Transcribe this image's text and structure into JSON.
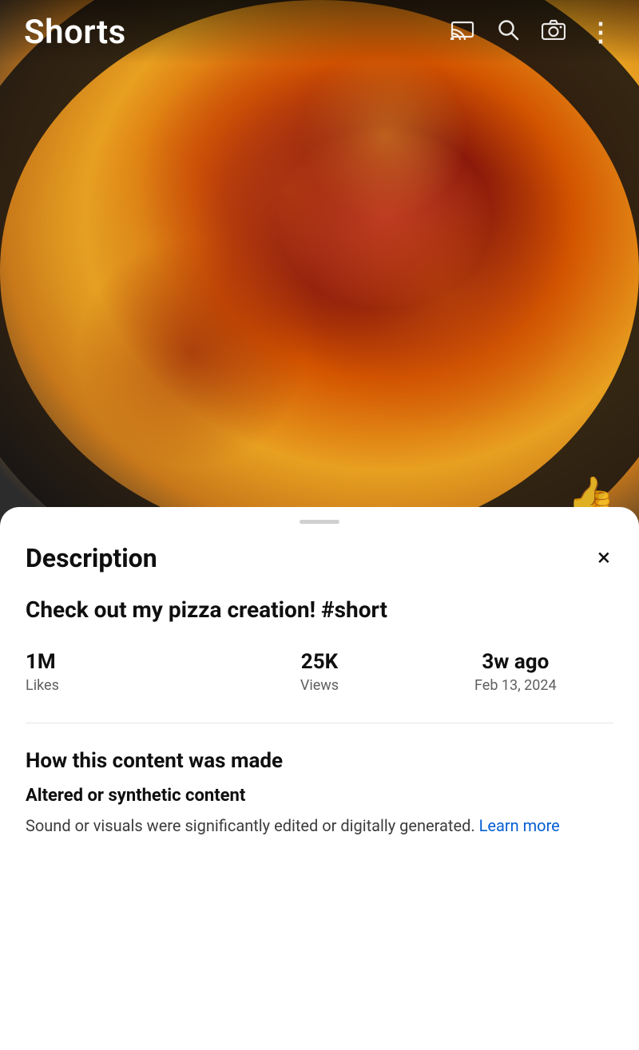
{
  "header": {
    "title": "Shorts",
    "icons": {
      "cast": "cast-icon",
      "search": "⌕",
      "camera": "📷",
      "more": "⋮"
    }
  },
  "video": {
    "thumbs_up_icon": "👍"
  },
  "description_sheet": {
    "title": "Description",
    "close_label": "×",
    "video_title": "Check out my pizza creation! #short",
    "stats": [
      {
        "value": "1M",
        "label": "Likes"
      },
      {
        "value": "25K",
        "label": "Views"
      },
      {
        "value": "3w ago",
        "label": "Feb 13, 2024"
      }
    ],
    "how_made_section": "How this content was made",
    "content_type_label": "Altered or synthetic content",
    "content_desc_part1": "Sound or visuals were significantly edited or digitally generated. ",
    "learn_more_label": "Learn more",
    "drag_handle_label": "drag-handle"
  }
}
